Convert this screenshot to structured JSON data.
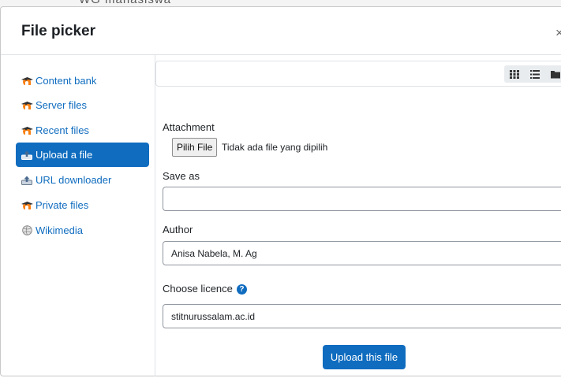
{
  "background_text": "WG mahasiswa",
  "dialog": {
    "title": "File picker",
    "close": "×"
  },
  "sidebar": {
    "items": [
      {
        "label": "Content bank",
        "icon": "moodle-icon",
        "active": false
      },
      {
        "label": "Server files",
        "icon": "moodle-icon",
        "active": false
      },
      {
        "label": "Recent files",
        "icon": "moodle-icon",
        "active": false
      },
      {
        "label": "Upload a file",
        "icon": "upload-icon",
        "active": true
      },
      {
        "label": "URL downloader",
        "icon": "url-icon",
        "active": false
      },
      {
        "label": "Private files",
        "icon": "moodle-icon",
        "active": false
      },
      {
        "label": "Wikimedia",
        "icon": "wikimedia-icon",
        "active": false
      }
    ]
  },
  "toolbar": {
    "views": [
      "icons-view-icon",
      "list-view-icon",
      "folder-view-icon"
    ]
  },
  "form": {
    "attachment_label": "Attachment",
    "file_button": "Pilih File",
    "file_status": "Tidak ada file yang dipilih",
    "save_as_label": "Save as",
    "save_as_value": "",
    "author_label": "Author",
    "author_value": "Anisa Nabela, M. Ag",
    "licence_label": "Choose licence",
    "licence_value": "stitnurussalam.ac.id",
    "upload_button": "Upload this file"
  },
  "colors": {
    "accent": "#0f6cbf",
    "moodle_orange": "#f98012"
  }
}
